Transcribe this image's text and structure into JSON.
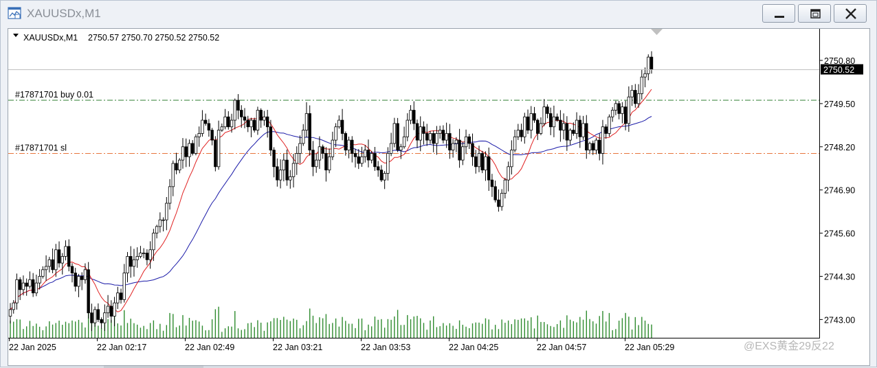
{
  "window": {
    "title": "XAUUSDx,M1",
    "icon": "chart-window-icon",
    "controls": {
      "minimize": "minimize-icon",
      "restore": "restore-icon",
      "close": "close-icon"
    }
  },
  "watermark": "@EXS黄金29反22",
  "chart_data": {
    "type": "candlestick",
    "symbol_header": "XAUUSDx,M1",
    "ohlc_header": "2750.57 2750.70 2750.52 2750.52",
    "current_price": "2750.52",
    "y_ticks": [
      "2750.80",
      "2749.50",
      "2748.20",
      "2746.90",
      "2745.60",
      "2744.30",
      "2743.00"
    ],
    "y_tick_values": [
      2750.8,
      2749.5,
      2748.2,
      2746.9,
      2745.6,
      2744.3,
      2743.0
    ],
    "ylim": [
      2742.45,
      2751.75
    ],
    "x_ticks": [
      "22 Jan 2025",
      "22 Jan 02:17",
      "22 Jan 02:49",
      "22 Jan 03:21",
      "22 Jan 03:53",
      "22 Jan 04:25",
      "22 Jan 04:57",
      "22 Jan 05:29"
    ],
    "order_lines": [
      {
        "label": "#17871701 buy 0.01",
        "price": 2749.6,
        "color": "#2e7d32"
      },
      {
        "label": "#17871701 sl",
        "price": 2748.0,
        "color": "#e8743a"
      }
    ],
    "ma_fast_color": "#e02020",
    "ma_slow_color": "#1a1aa8",
    "up_color": "#ffffff",
    "down_color": "#000000",
    "volume_color": "#2e8b2e",
    "close_values": [
      2743.3,
      2743.5,
      2744.2,
      2743.9,
      2744.1,
      2744.0,
      2744.2,
      2743.8,
      2744.1,
      2744.3,
      2744.5,
      2744.6,
      2744.8,
      2744.5,
      2745.1,
      2744.7,
      2744.9,
      2745.2,
      2744.6,
      2744.4,
      2744.0,
      2744.3,
      2744.2,
      2744.5,
      2743.2,
      2742.9,
      2743.3,
      2743.0,
      2742.9,
      2743.2,
      2743.4,
      2743.1,
      2743.5,
      2743.8,
      2743.6,
      2744.4,
      2744.9,
      2744.6,
      2744.8,
      2744.9,
      2745.0,
      2745.0,
      2744.8,
      2745.1,
      2745.6,
      2745.8,
      2746.0,
      2746.0,
      2746.5,
      2747.0,
      2747.7,
      2747.5,
      2747.8,
      2748.2,
      2747.9,
      2748.3,
      2748.0,
      2748.5,
      2748.6,
      2749.0,
      2748.9,
      2748.7,
      2748.4,
      2747.6,
      2748.7,
      2748.8,
      2749.1,
      2748.8,
      2749.0,
      2749.6,
      2749.3,
      2749.1,
      2749.0,
      2748.8,
      2749.0,
      2748.7,
      2749.3,
      2749.0,
      2749.1,
      2748.8,
      2748.1,
      2747.6,
      2747.2,
      2747.5,
      2747.8,
      2747.2,
      2747.3,
      2747.7,
      2748.0,
      2748.3,
      2748.7,
      2749.2,
      2748.1,
      2747.6,
      2747.8,
      2748.2,
      2748.0,
      2747.5,
      2747.9,
      2748.4,
      2748.8,
      2749.0,
      2748.6,
      2748.1,
      2748.4,
      2748.0,
      2747.9,
      2747.7,
      2747.9,
      2748.1,
      2747.8,
      2748.0,
      2747.6,
      2747.5,
      2747.2,
      2747.4,
      2748.0,
      2748.3,
      2748.9,
      2748.1,
      2748.2,
      2748.5,
      2749.0,
      2749.3,
      2748.9,
      2748.4,
      2748.8,
      2748.6,
      2748.4,
      2748.6,
      2748.3,
      2748.6,
      2748.7,
      2748.4,
      2748.6,
      2748.1,
      2748.3,
      2748.4,
      2747.8,
      2748.2,
      2748.5,
      2748.3,
      2747.9,
      2747.6,
      2748.0,
      2747.5,
      2747.9,
      2747.2,
      2747.0,
      2746.6,
      2746.4,
      2746.8,
      2747.2,
      2747.6,
      2748.1,
      2748.5,
      2748.7,
      2748.5,
      2749.1,
      2748.7,
      2749.2,
      2749.0,
      2748.6,
      2748.9,
      2749.4,
      2749.2,
      2748.8,
      2749.1,
      2749.0,
      2748.7,
      2748.9,
      2748.4,
      2748.7,
      2748.6,
      2749.0,
      2748.5,
      2748.9,
      2748.1,
      2748.3,
      2748.1,
      2748.4,
      2748.0,
      2748.8,
      2748.6,
      2749.1,
      2749.3,
      2749.5,
      2749.2,
      2749.4,
      2748.9,
      2749.7,
      2749.9,
      2749.5,
      2749.8,
      2750.3,
      2750.4,
      2750.9,
      2750.52
    ]
  }
}
